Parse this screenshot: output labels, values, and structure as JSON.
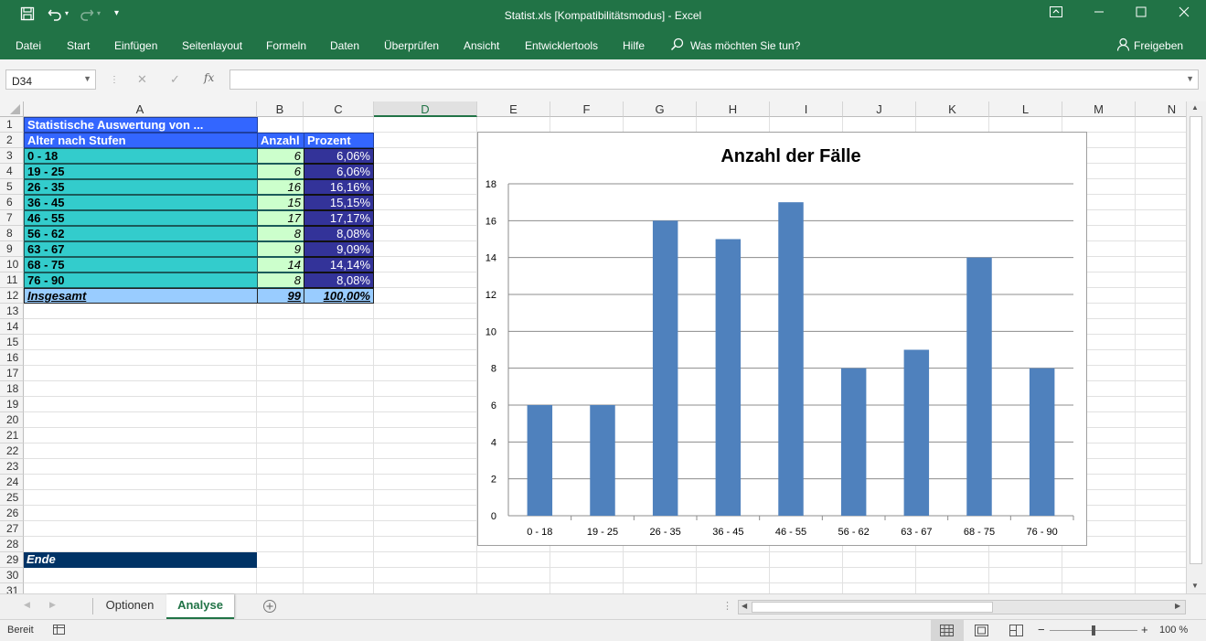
{
  "window": {
    "title": "Statist.xls  [Kompatibilitätsmodus]  -  Excel",
    "quick_access": {
      "save": "save-icon",
      "undo": "undo-icon",
      "redo": "redo-icon",
      "customize": "customize-icon"
    },
    "controls": {
      "ribbon_options": "ribbon-display-options-icon",
      "minimize": "minimize-icon",
      "maximize": "maximize-icon",
      "close": "close-icon"
    }
  },
  "menu": {
    "items": [
      "Datei",
      "Start",
      "Einfügen",
      "Seitenlayout",
      "Formeln",
      "Daten",
      "Überprüfen",
      "Ansicht",
      "Entwicklertools",
      "Hilfe"
    ],
    "search_placeholder": "Was möchten Sie tun?",
    "share": "Freigeben"
  },
  "formula_bar": {
    "name_box": "D34",
    "fx": "fx",
    "formula": ""
  },
  "columns": [
    "A",
    "B",
    "C",
    "D",
    "E",
    "F",
    "G",
    "H",
    "I",
    "J",
    "K",
    "L",
    "M",
    "N"
  ],
  "selected_column": "D",
  "rows": [
    "1",
    "2",
    "3",
    "4",
    "5",
    "6",
    "7",
    "8",
    "9",
    "10",
    "11",
    "12",
    "13",
    "14",
    "15",
    "16",
    "17",
    "18",
    "19",
    "20",
    "21",
    "22",
    "23",
    "24",
    "25",
    "26",
    "27",
    "28",
    "29",
    "30",
    "31"
  ],
  "table": {
    "title": "Statistische Auswertung von ...",
    "headers": [
      "Alter nach Stufen",
      "Anzahl",
      "Prozent"
    ],
    "rows": [
      {
        "label": "0 - 18",
        "count": "6",
        "percent": "6,06%"
      },
      {
        "label": "19 - 25",
        "count": "6",
        "percent": "6,06%"
      },
      {
        "label": "26 - 35",
        "count": "16",
        "percent": "16,16%"
      },
      {
        "label": "36 - 45",
        "count": "15",
        "percent": "15,15%"
      },
      {
        "label": "46 - 55",
        "count": "17",
        "percent": "17,17%"
      },
      {
        "label": "56 - 62",
        "count": "8",
        "percent": "8,08%"
      },
      {
        "label": "63 - 67",
        "count": "9",
        "percent": "9,09%"
      },
      {
        "label": "68 - 75",
        "count": "14",
        "percent": "14,14%"
      },
      {
        "label": "76 - 90",
        "count": "8",
        "percent": "8,08%"
      }
    ],
    "total": {
      "label": "Insgesamt",
      "count": "99",
      "percent": "100,00%"
    },
    "end_label": "Ende"
  },
  "chart_data": {
    "type": "bar",
    "title": "Anzahl der Fälle",
    "categories": [
      "0 - 18",
      "19 - 25",
      "26 - 35",
      "36 - 45",
      "46 - 55",
      "56 - 62",
      "63 - 67",
      "68 - 75",
      "76 - 90"
    ],
    "values": [
      6,
      6,
      16,
      15,
      17,
      8,
      9,
      14,
      8
    ],
    "xlabel": "",
    "ylabel": "",
    "ylim": [
      0,
      18
    ],
    "yticks": [
      0,
      2,
      4,
      6,
      8,
      10,
      12,
      14,
      16,
      18
    ],
    "grid": true,
    "legend": "none",
    "bar_color": "#4f81bd"
  },
  "sheets": {
    "tabs": [
      "Optionen",
      "Analyse"
    ],
    "active": "Analyse"
  },
  "status": {
    "text": "Bereit",
    "zoom": "100 %",
    "zoom_level": 1.0
  },
  "colors": {
    "excel_green": "#217346",
    "header_blue": "#3366ff",
    "category_teal": "#33cccc",
    "count_green": "#ccffcc",
    "percent_indigo": "#333399",
    "total_blue": "#99ccff",
    "end_navy": "#003366"
  }
}
